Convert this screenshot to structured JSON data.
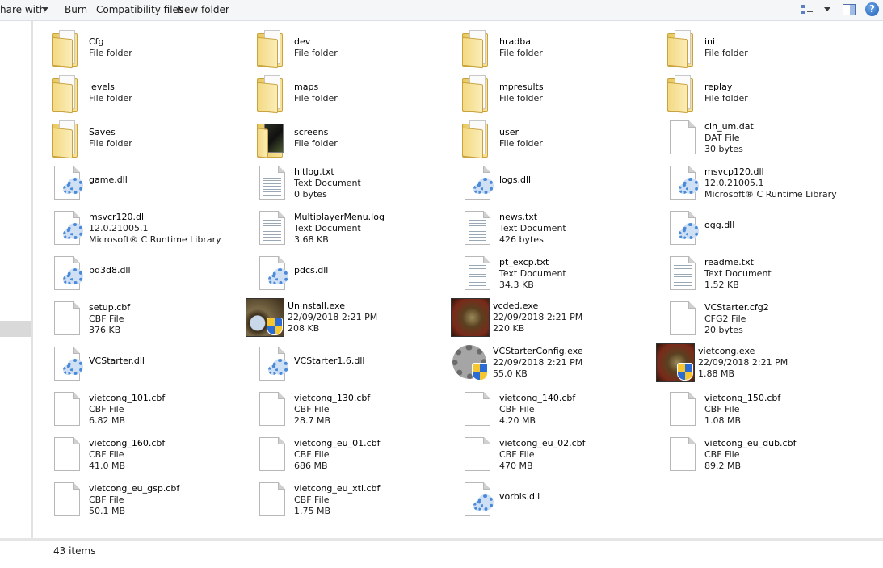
{
  "toolbar": {
    "share_label": "hare with",
    "burn_label": "Burn",
    "compat_label": "Compatibility files",
    "new_folder_label": "New folder",
    "help_label": "?"
  },
  "items": [
    {
      "name": "Cfg",
      "l1": "File folder",
      "l2": "",
      "l3": "",
      "icon": "folder"
    },
    {
      "name": "dev",
      "l1": "File folder",
      "l2": "",
      "l3": "",
      "icon": "folder"
    },
    {
      "name": "hradba",
      "l1": "File folder",
      "l2": "",
      "l3": "",
      "icon": "folder"
    },
    {
      "name": "ini",
      "l1": "File folder",
      "l2": "",
      "l3": "",
      "icon": "folder"
    },
    {
      "name": "levels",
      "l1": "File folder",
      "l2": "",
      "l3": "",
      "icon": "folder"
    },
    {
      "name": "maps",
      "l1": "File folder",
      "l2": "",
      "l3": "",
      "icon": "folder"
    },
    {
      "name": "mpresults",
      "l1": "File folder",
      "l2": "",
      "l3": "",
      "icon": "folder"
    },
    {
      "name": "replay",
      "l1": "File folder",
      "l2": "",
      "l3": "",
      "icon": "folder"
    },
    {
      "name": "Saves",
      "l1": "File folder",
      "l2": "",
      "l3": "",
      "icon": "folder"
    },
    {
      "name": "screens",
      "l1": "File folder",
      "l2": "",
      "l3": "",
      "icon": "folder-dark"
    },
    {
      "name": "user",
      "l1": "File folder",
      "l2": "",
      "l3": "",
      "icon": "folder"
    },
    {
      "name": "cln_um.dat",
      "l1": "DAT File",
      "l2": "30 bytes",
      "l3": "",
      "icon": "doc"
    },
    {
      "name": "game.dll",
      "l1": "",
      "l2": "",
      "l3": "",
      "icon": "dll"
    },
    {
      "name": "hitlog.txt",
      "l1": "Text Document",
      "l2": "0 bytes",
      "l3": "",
      "icon": "txt"
    },
    {
      "name": "logs.dll",
      "l1": "",
      "l2": "",
      "l3": "",
      "icon": "dll"
    },
    {
      "name": "msvcp120.dll",
      "l1": "12.0.21005.1",
      "l2": "Microsoft® C Runtime Library",
      "l3": "",
      "icon": "dll"
    },
    {
      "name": "msvcr120.dll",
      "l1": "12.0.21005.1",
      "l2": "Microsoft® C Runtime Library",
      "l3": "",
      "icon": "dll"
    },
    {
      "name": "MultiplayerMenu.log",
      "l1": "Text Document",
      "l2": "3.68 KB",
      "l3": "",
      "icon": "txt"
    },
    {
      "name": "news.txt",
      "l1": "Text Document",
      "l2": "426 bytes",
      "l3": "",
      "icon": "txt"
    },
    {
      "name": "ogg.dll",
      "l1": "",
      "l2": "",
      "l3": "",
      "icon": "dll"
    },
    {
      "name": "pd3d8.dll",
      "l1": "",
      "l2": "",
      "l3": "",
      "icon": "dll"
    },
    {
      "name": "pdcs.dll",
      "l1": "",
      "l2": "",
      "l3": "",
      "icon": "dll"
    },
    {
      "name": "pt_excp.txt",
      "l1": "Text Document",
      "l2": "34.3 KB",
      "l3": "",
      "icon": "txt"
    },
    {
      "name": "readme.txt",
      "l1": "Text Document",
      "l2": "1.52 KB",
      "l3": "",
      "icon": "txt"
    },
    {
      "name": "setup.cbf",
      "l1": "CBF File",
      "l2": "376 KB",
      "l3": "",
      "icon": "doc"
    },
    {
      "name": "Uninstall.exe",
      "l1": "22/09/2018 2:21 PM",
      "l2": "208 KB",
      "l3": "",
      "icon": "exe-cd"
    },
    {
      "name": "vcded.exe",
      "l1": "22/09/2018 2:21 PM",
      "l2": "220 KB",
      "l3": "",
      "icon": "exe-face"
    },
    {
      "name": "VCStarter.cfg2",
      "l1": "CFG2 File",
      "l2": "20 bytes",
      "l3": "",
      "icon": "doc"
    },
    {
      "name": "VCStarter.dll",
      "l1": "",
      "l2": "",
      "l3": "",
      "icon": "dll"
    },
    {
      "name": "VCStarter1.6.dll",
      "l1": "",
      "l2": "",
      "l3": "",
      "icon": "dll"
    },
    {
      "name": "VCStarterConfig.exe",
      "l1": "22/09/2018 2:21 PM",
      "l2": "55.0 KB",
      "l3": "",
      "icon": "exe-gear"
    },
    {
      "name": "vietcong.exe",
      "l1": "22/09/2018 2:21 PM",
      "l2": "1.88 MB",
      "l3": "",
      "icon": "exe-face-shield"
    },
    {
      "name": "vietcong_101.cbf",
      "l1": "CBF File",
      "l2": "6.82 MB",
      "l3": "",
      "icon": "doc"
    },
    {
      "name": "vietcong_130.cbf",
      "l1": "CBF File",
      "l2": "28.7 MB",
      "l3": "",
      "icon": "doc"
    },
    {
      "name": "vietcong_140.cbf",
      "l1": "CBF File",
      "l2": "4.20 MB",
      "l3": "",
      "icon": "doc"
    },
    {
      "name": "vietcong_150.cbf",
      "l1": "CBF File",
      "l2": "1.08 MB",
      "l3": "",
      "icon": "doc"
    },
    {
      "name": "vietcong_160.cbf",
      "l1": "CBF File",
      "l2": "41.0 MB",
      "l3": "",
      "icon": "doc"
    },
    {
      "name": "vietcong_eu_01.cbf",
      "l1": "CBF File",
      "l2": "686 MB",
      "l3": "",
      "icon": "doc"
    },
    {
      "name": "vietcong_eu_02.cbf",
      "l1": "CBF File",
      "l2": "470 MB",
      "l3": "",
      "icon": "doc"
    },
    {
      "name": "vietcong_eu_dub.cbf",
      "l1": "CBF File",
      "l2": "89.2 MB",
      "l3": "",
      "icon": "doc"
    },
    {
      "name": "vietcong_eu_gsp.cbf",
      "l1": "CBF File",
      "l2": "50.1 MB",
      "l3": "",
      "icon": "doc"
    },
    {
      "name": "vietcong_eu_xtl.cbf",
      "l1": "CBF File",
      "l2": "1.75 MB",
      "l3": "",
      "icon": "doc"
    },
    {
      "name": "vorbis.dll",
      "l1": "",
      "l2": "",
      "l3": "",
      "icon": "dll"
    }
  ],
  "status": {
    "count_label": "43 items"
  }
}
